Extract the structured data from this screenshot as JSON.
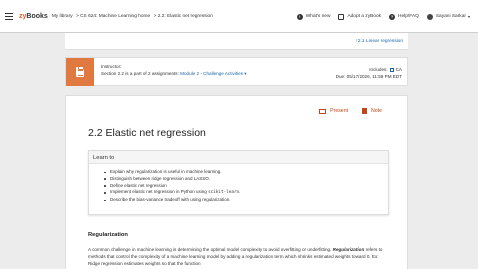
{
  "topbar": {
    "logo_zy": "zy",
    "logo_books": "Books",
    "breadcrumb": [
      "My library",
      "> CS 624: Machine Learning home",
      "> 2.2: Elastic net regression"
    ],
    "whats_new": "What's new",
    "adopt": "Adopt a zyBook",
    "help": "Help/FAQ",
    "user": "Sayani Sarkar",
    "whats_new_badge": "!",
    "help_badge": "?"
  },
  "section_link": "↑2.1 Linear regression",
  "banner": {
    "instructor_label": "Instructor:",
    "assignment_text": "Section 2.2 is a part of 2 assignments:",
    "assignment_link": "Module 2 - Challenge Activities ▾",
    "includes_label": "Includes:",
    "includes_value": "CA",
    "due": "Due: 05/17/2026, 11:59 PM EDT"
  },
  "actions": {
    "present": "Present",
    "note": "Note"
  },
  "page_title": "2.2 Elastic net regression",
  "learn": {
    "heading": "Learn to",
    "items": [
      "Explain why regularization is useful in machine learning.",
      "Distinguish between ridge regression and LASSO.",
      "Define elastic net regression",
      "Implement elastic net regression in Python using",
      "Describe the bias-variance tradeoff with using regularization."
    ],
    "code": "scikit-learn",
    "code_suffix": "."
  },
  "regularization": {
    "heading": "Regularization",
    "para_part1": "A common challenge in machine learning is determining the optimal model complexity to avoid overfitting or underfitting.",
    "para_term": "Regularization",
    "para_part2": "refers to methods that control the complexity of a machine learning model by adding a regularization term which shrinks estimated weights toward 0. Ex: Ridge regression estimates weights so that the function"
  }
}
